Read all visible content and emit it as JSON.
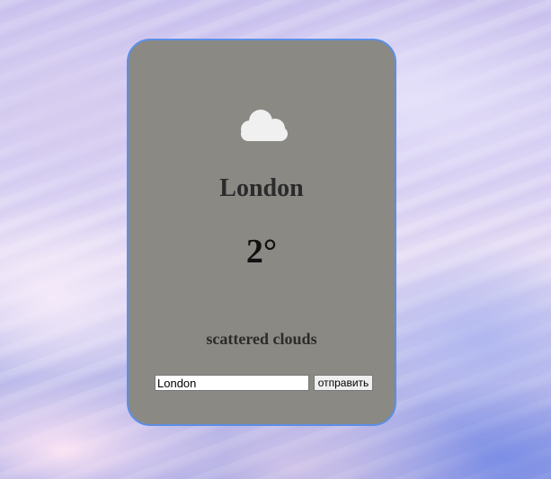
{
  "weather": {
    "icon": "cloud-icon",
    "city": "London",
    "temperature": "2°",
    "description": "scattered clouds"
  },
  "form": {
    "input_value": "London",
    "submit_label": "отправить"
  },
  "colors": {
    "card_background": "#8b8984",
    "card_border": "#5c8fe6",
    "icon_color": "#f0f0f0"
  }
}
